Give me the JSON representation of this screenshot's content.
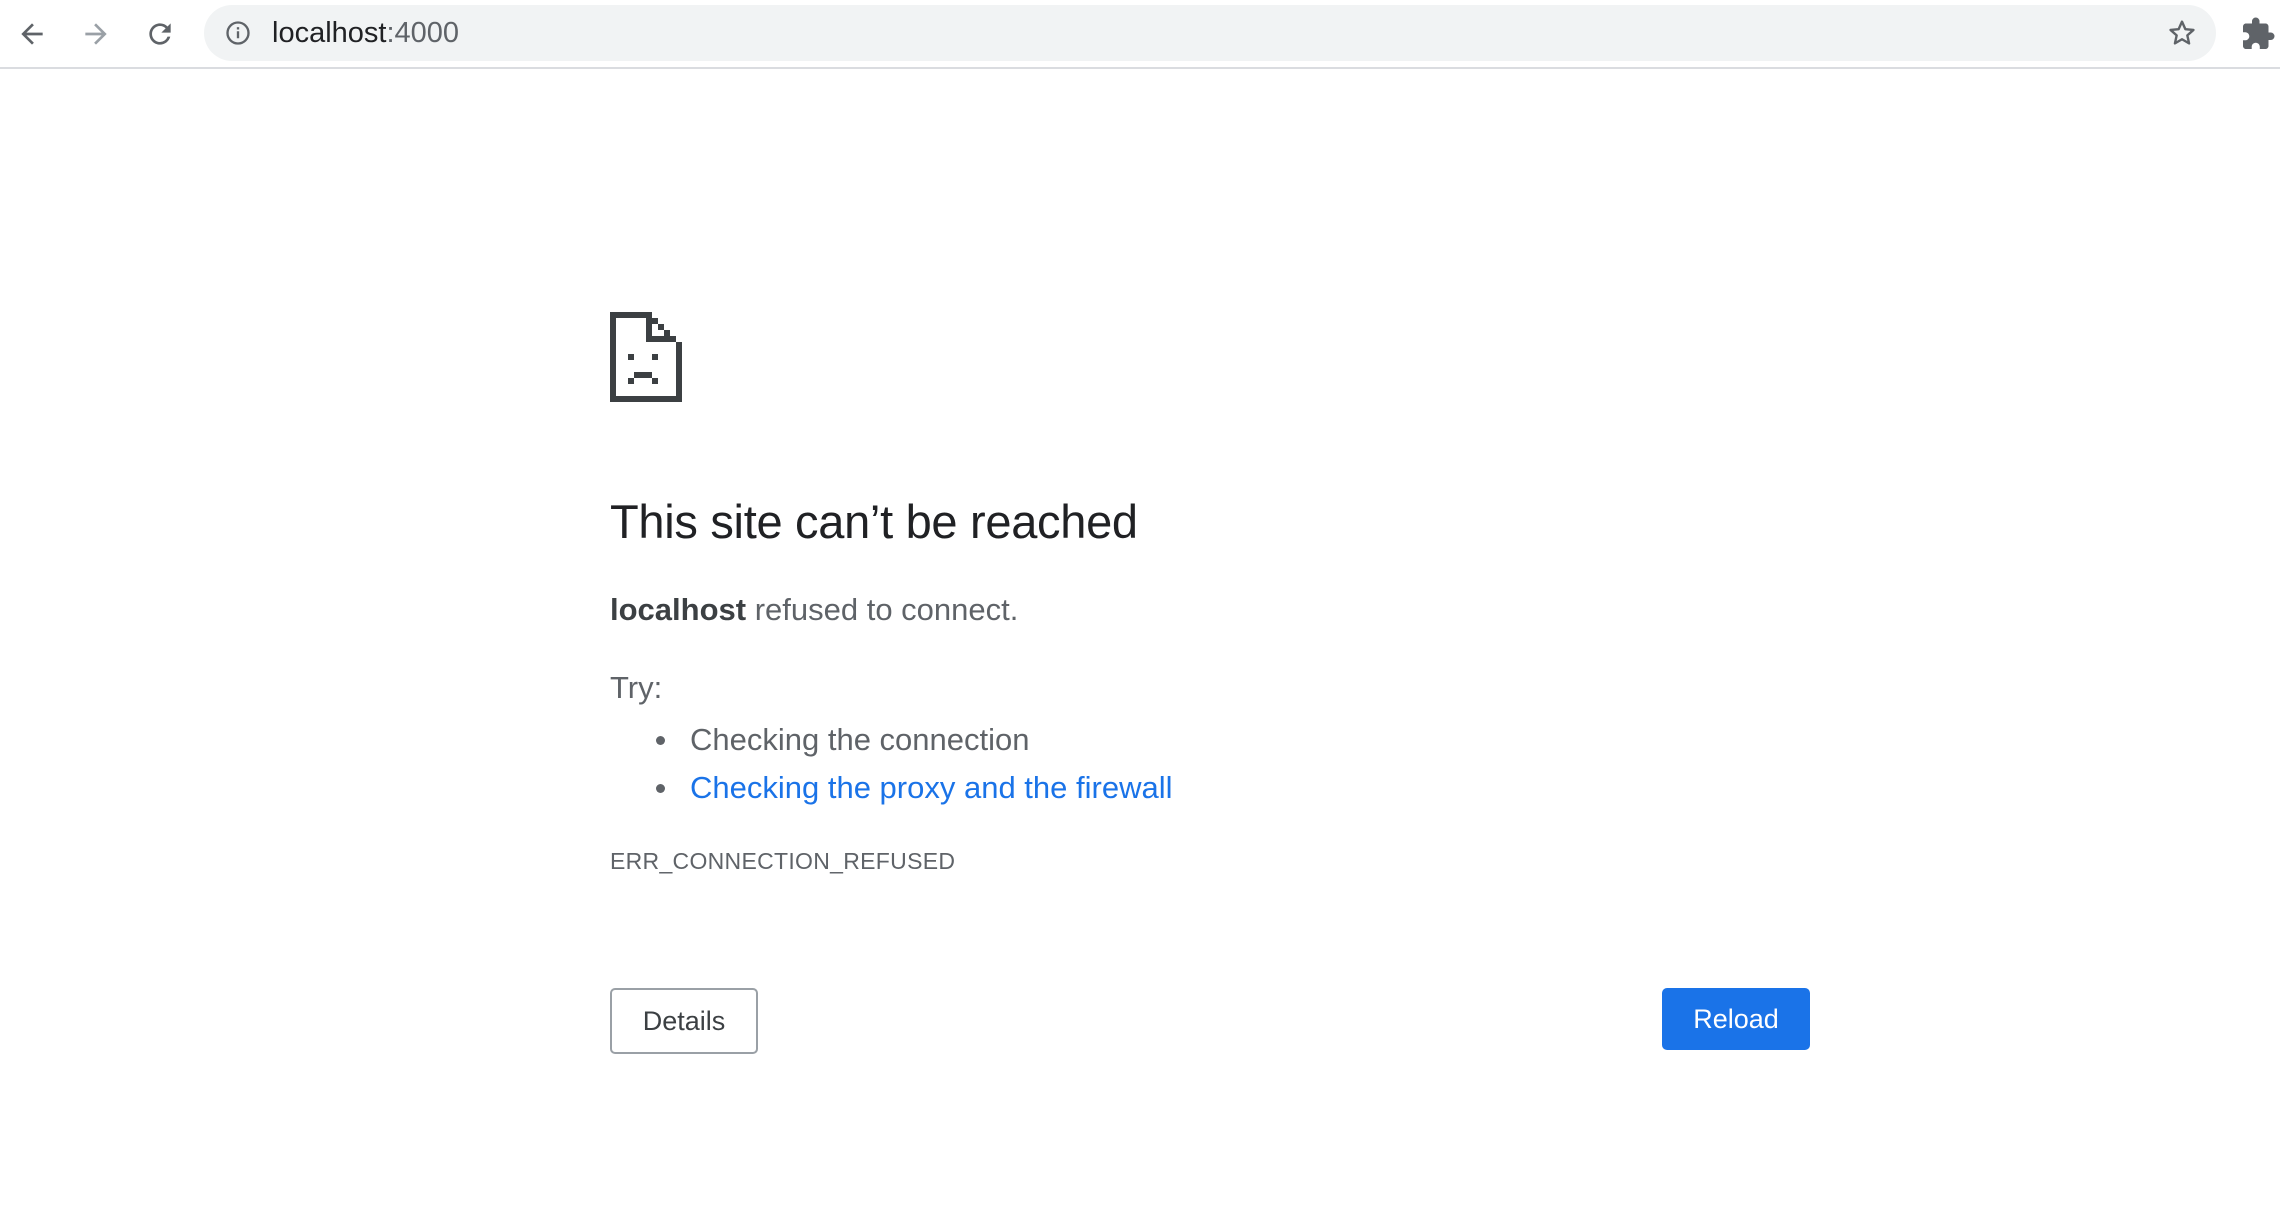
{
  "browser": {
    "url_host": "localhost",
    "url_port": ":4000",
    "icons": {
      "back": "arrow-left-icon",
      "forward": "arrow-right-icon",
      "reload": "reload-icon",
      "info": "info-icon",
      "bookmark": "star-icon",
      "extensions": "puzzle-icon"
    }
  },
  "error_page": {
    "icon": "sad-document-icon",
    "headline": "This site can’t be reached",
    "host": "localhost",
    "message": " refused to connect.",
    "try_label": "Try:",
    "suggestions": [
      {
        "label": "Checking the connection",
        "is_link": false
      },
      {
        "label": "Checking the proxy and the firewall",
        "is_link": true
      }
    ],
    "error_code": "ERR_CONNECTION_REFUSED",
    "details_label": "Details",
    "reload_label": "Reload"
  },
  "colors": {
    "accent": "#1a73e8",
    "text_primary": "#202124",
    "text_secondary": "#5f6368",
    "omnibox_bg": "#f1f3f4"
  }
}
